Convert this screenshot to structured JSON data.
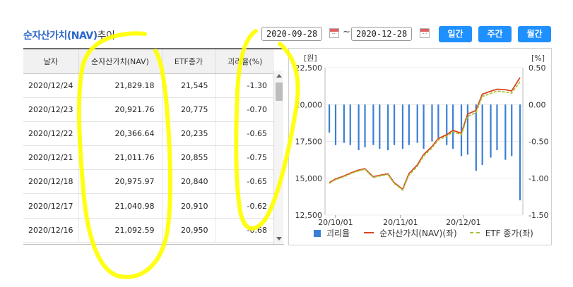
{
  "header": {
    "title_main": "순자산가치(NAV)",
    "title_suffix": "추이"
  },
  "date_range": {
    "start": "2020-09-28",
    "separator": "~",
    "end": "2020-12-28"
  },
  "period_buttons": [
    "일간",
    "주간",
    "월간"
  ],
  "colors": {
    "accent": "#1e90ff",
    "title": "#2a66c9",
    "bar": "#3a7fd5",
    "nav_line": "#d9451e",
    "etf_line": "#a9c23a",
    "highlight": "#ffff00"
  },
  "table": {
    "columns": [
      "날자",
      "순자산가치(NAV)",
      "ETF종가",
      "괴리율(%)"
    ],
    "rows": [
      [
        "2020/12/24",
        "21,829.18",
        "21,545",
        "-1.30"
      ],
      [
        "2020/12/23",
        "20,921.76",
        "20,775",
        "-0.70"
      ],
      [
        "2020/12/22",
        "20,366.64",
        "20,235",
        "-0.65"
      ],
      [
        "2020/12/21",
        "21,011.76",
        "20,855",
        "-0.75"
      ],
      [
        "2020/12/18",
        "20,975.97",
        "20,840",
        "-0.65"
      ],
      [
        "2020/12/17",
        "21,040.98",
        "20,910",
        "-0.62"
      ],
      [
        "2020/12/16",
        "21,092.59",
        "20,950",
        "-0.68"
      ]
    ]
  },
  "chart": {
    "left_unit": "[원]",
    "right_unit": "[%]",
    "left_ticks": [
      "22,500",
      "20,000",
      "17,500",
      "15,000",
      "12,500"
    ],
    "right_ticks": [
      "0.50",
      "0.00",
      "-0.50",
      "-1.00",
      "-1.50"
    ],
    "x_ticks": [
      "20/10/01",
      "20/11/01",
      "20/12/01"
    ],
    "legend": [
      "괴리율",
      "순자산가치(NAV)(좌)",
      "ETF 종가(좌)"
    ]
  },
  "chart_data": {
    "type": "line",
    "left_axis": {
      "label": "원",
      "ylim": [
        12500,
        22500
      ]
    },
    "right_axis": {
      "label": "%",
      "ylim": [
        -1.5,
        0.5
      ]
    },
    "x": [
      "2020-09-28",
      "2020-10-01",
      "2020-10-05",
      "2020-10-08",
      "2020-10-12",
      "2020-10-15",
      "2020-10-19",
      "2020-10-22",
      "2020-10-26",
      "2020-10-29",
      "2020-11-02",
      "2020-11-05",
      "2020-11-09",
      "2020-11-12",
      "2020-11-16",
      "2020-11-19",
      "2020-11-23",
      "2020-11-26",
      "2020-11-30",
      "2020-12-03",
      "2020-12-07",
      "2020-12-10",
      "2020-12-14",
      "2020-12-17",
      "2020-12-21",
      "2020-12-24",
      "2020-12-28"
    ],
    "series": [
      {
        "name": "순자산가치(NAV)(좌)",
        "axis": "left",
        "values": [
          14700,
          14950,
          15150,
          15350,
          15550,
          15650,
          15100,
          15200,
          15300,
          14700,
          14250,
          15300,
          15900,
          16600,
          17150,
          17700,
          17950,
          18250,
          18050,
          19350,
          19600,
          20700,
          20900,
          21040,
          21010,
          20920,
          21829
        ]
      },
      {
        "name": "ETF 종가(좌)",
        "axis": "left",
        "values": [
          14650,
          14900,
          15100,
          15300,
          15500,
          15600,
          15050,
          15150,
          15250,
          14650,
          14200,
          15200,
          15800,
          16500,
          17050,
          17600,
          17850,
          18150,
          17950,
          19200,
          19450,
          20550,
          20750,
          20910,
          20855,
          20775,
          21545
        ]
      },
      {
        "name": "괴리율",
        "axis": "right",
        "type": "bar",
        "values": [
          -0.38,
          -0.55,
          -0.52,
          -0.55,
          -0.62,
          -0.58,
          -0.55,
          -0.6,
          -0.62,
          -0.55,
          -0.6,
          -0.55,
          -0.52,
          -0.6,
          -0.5,
          -0.45,
          -0.55,
          -0.6,
          -0.7,
          -0.68,
          -0.9,
          -0.82,
          -0.72,
          -0.62,
          -0.75,
          -0.7,
          -1.3
        ]
      }
    ]
  }
}
